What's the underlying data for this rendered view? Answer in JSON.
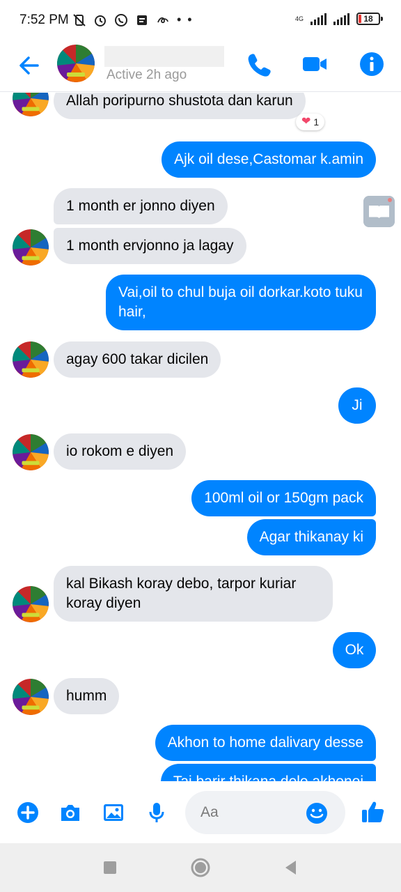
{
  "status_bar": {
    "time": "7:52 PM",
    "network": "4G",
    "battery": "18",
    "more": "• •"
  },
  "header": {
    "contact_name": "",
    "active_status": "Active 2h ago",
    "accent_color": "#0084ff"
  },
  "messages": [
    {
      "dir": "in",
      "text": "Allah poripurno shustota dan karun",
      "avatar": false
    },
    {
      "dir": "out",
      "text": "Ajk oil dese,Castomar k.amin"
    },
    {
      "dir": "in",
      "text": "1 month er jonno diyen",
      "avatar": false
    },
    {
      "dir": "in",
      "text": "1 month ervjonno ja lagay",
      "avatar": true
    },
    {
      "dir": "out",
      "text": "Vai,oil to chul buja oil dorkar.koto tuku hair,"
    },
    {
      "dir": "in",
      "text": "agay 600 takar dicilen",
      "avatar": true
    },
    {
      "dir": "out",
      "text": "Ji"
    },
    {
      "dir": "in",
      "text": "io rokom e diyen",
      "avatar": true
    },
    {
      "dir": "out",
      "text": "100ml oil or 150gm pack"
    },
    {
      "dir": "out",
      "text": "Agar thikanay ki"
    },
    {
      "dir": "in",
      "text": "kal Bikash koray debo, tarpor kuriar koray diyen",
      "avatar": true
    },
    {
      "dir": "out",
      "text": "Ok"
    },
    {
      "dir": "in",
      "text": "humm",
      "avatar": true
    },
    {
      "dir": "out",
      "text": "Akhon to home dalivary desse"
    },
    {
      "dir": "out",
      "text": "Tai barir thikana dele akhonoi"
    }
  ],
  "reaction": {
    "emoji": "❤",
    "count": "1"
  },
  "composer": {
    "placeholder": "Aa"
  }
}
